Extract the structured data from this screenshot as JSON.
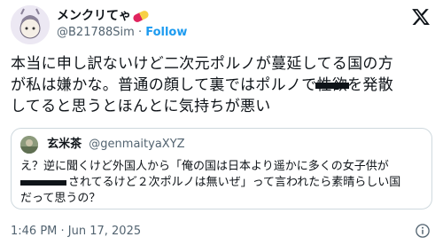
{
  "author": {
    "display_name": "メンクリてゃ",
    "handle": "@B21788Sim",
    "separator": "·",
    "follow_label": "Follow",
    "emoji_icon": "pill-icon"
  },
  "tweet": {
    "line1": "本当に申し訳ないけど二次元ポルノが蔓延してる国の方",
    "line2_pre": "が私は嫌かな。普通の顔して裏ではポルノで",
    "line2_redacted": "性欲",
    "line2_post": "を発散",
    "line3": "してると思うとほんとに気持ちが悪い"
  },
  "quote": {
    "display_name": "玄米茶",
    "handle": "@genmaityaXYZ",
    "line1": "え？逆に聞くけど外国人から「俺の国は日本より遥かに多くの女子供が",
    "line2": "されてるけど２次ポルノは無いぜ」って言われたら素晴らしい国",
    "line3": "だって思うの？"
  },
  "meta": {
    "timestamp": "1:46 PM · Jun 17, 2025"
  },
  "colors": {
    "accent": "#1d9bf0",
    "secondary_text": "#536471",
    "border": "#cfd9de"
  }
}
